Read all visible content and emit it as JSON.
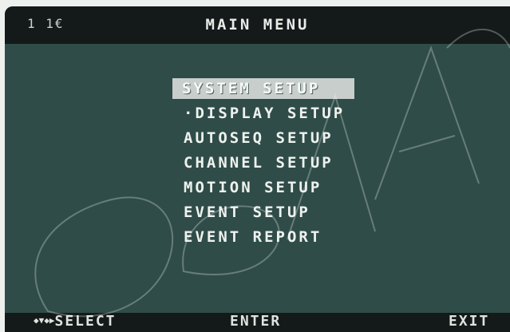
{
  "header": {
    "channel_indicator": "1 1€",
    "title": "MAIN MENU"
  },
  "menu": {
    "selected_index": 0,
    "items": [
      {
        "label": "SYSTEM SETUP"
      },
      {
        "label": "·DISPLAY SETUP"
      },
      {
        "label": "AUTOSEQ SETUP"
      },
      {
        "label": "CHANNEL SETUP"
      },
      {
        "label": "MOTION SETUP"
      },
      {
        "label": "EVENT SETUP"
      },
      {
        "label": "EVENT REPORT"
      }
    ]
  },
  "footer": {
    "select_arrows": "◆▼◆▶",
    "select_label": "SELECT",
    "enter_label": "ENTER",
    "exit_label": "EXIT"
  },
  "colors": {
    "screen_bg": "#2f4c48",
    "bar_bg": "#131a19",
    "highlight_bg": "#c7cecb",
    "text": "#eef2ee"
  }
}
